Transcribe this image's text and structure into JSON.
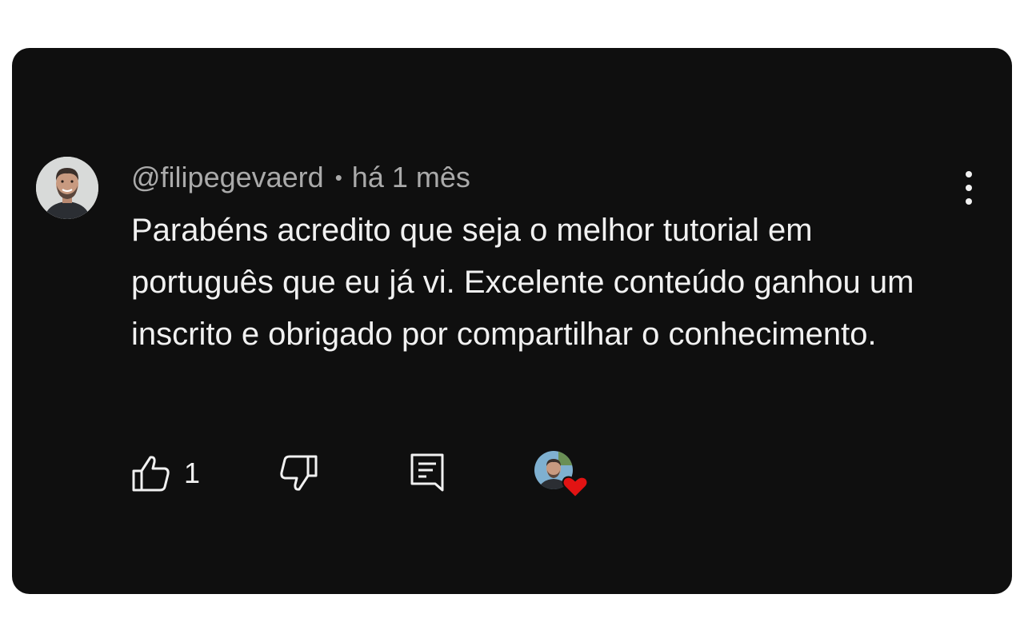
{
  "comment": {
    "username": "@filipegevaerd",
    "separator": "•",
    "time": "há 1 mês",
    "text": "Parabéns acredito que seja o melhor tutorial em português que eu já vi. Excelente conteúdo ganhou um inscrito e obrigado por compartilhar o conhecimento."
  },
  "actions": {
    "like_count": "1",
    "like_icon": "thumbs-up-icon",
    "dislike_icon": "thumbs-down-icon",
    "reply_icon": "reply-comment-icon",
    "creator_heart_icon": "heart-icon",
    "heart_color": "#e21313"
  },
  "colors": {
    "background": "#0f0f0f",
    "text": "#f1f1f1",
    "secondary_text": "#aaaaaa"
  }
}
